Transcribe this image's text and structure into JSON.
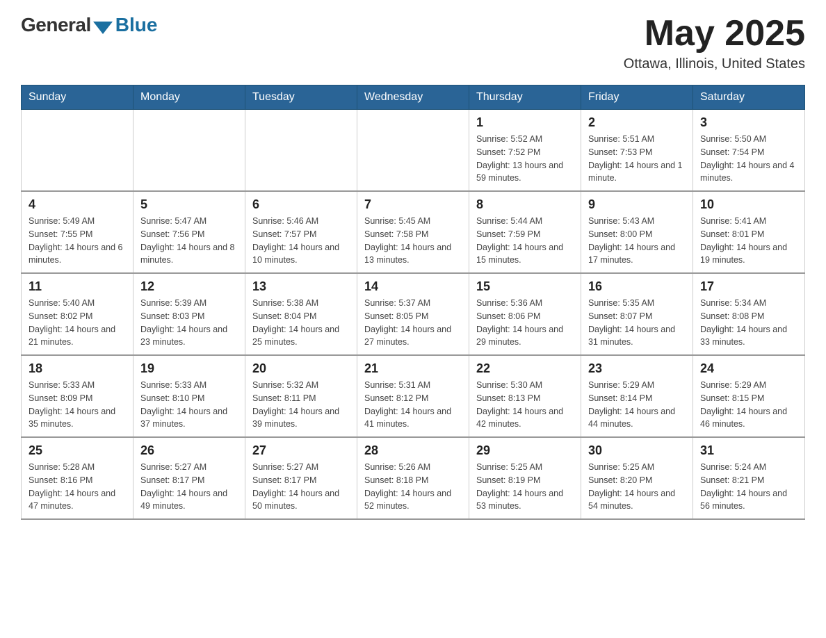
{
  "header": {
    "logo_general": "General",
    "logo_blue": "Blue",
    "month_year": "May 2025",
    "location": "Ottawa, Illinois, United States"
  },
  "days_of_week": [
    "Sunday",
    "Monday",
    "Tuesday",
    "Wednesday",
    "Thursday",
    "Friday",
    "Saturday"
  ],
  "weeks": [
    [
      {
        "day": "",
        "info": ""
      },
      {
        "day": "",
        "info": ""
      },
      {
        "day": "",
        "info": ""
      },
      {
        "day": "",
        "info": ""
      },
      {
        "day": "1",
        "info": "Sunrise: 5:52 AM\nSunset: 7:52 PM\nDaylight: 13 hours and 59 minutes."
      },
      {
        "day": "2",
        "info": "Sunrise: 5:51 AM\nSunset: 7:53 PM\nDaylight: 14 hours and 1 minute."
      },
      {
        "day": "3",
        "info": "Sunrise: 5:50 AM\nSunset: 7:54 PM\nDaylight: 14 hours and 4 minutes."
      }
    ],
    [
      {
        "day": "4",
        "info": "Sunrise: 5:49 AM\nSunset: 7:55 PM\nDaylight: 14 hours and 6 minutes."
      },
      {
        "day": "5",
        "info": "Sunrise: 5:47 AM\nSunset: 7:56 PM\nDaylight: 14 hours and 8 minutes."
      },
      {
        "day": "6",
        "info": "Sunrise: 5:46 AM\nSunset: 7:57 PM\nDaylight: 14 hours and 10 minutes."
      },
      {
        "day": "7",
        "info": "Sunrise: 5:45 AM\nSunset: 7:58 PM\nDaylight: 14 hours and 13 minutes."
      },
      {
        "day": "8",
        "info": "Sunrise: 5:44 AM\nSunset: 7:59 PM\nDaylight: 14 hours and 15 minutes."
      },
      {
        "day": "9",
        "info": "Sunrise: 5:43 AM\nSunset: 8:00 PM\nDaylight: 14 hours and 17 minutes."
      },
      {
        "day": "10",
        "info": "Sunrise: 5:41 AM\nSunset: 8:01 PM\nDaylight: 14 hours and 19 minutes."
      }
    ],
    [
      {
        "day": "11",
        "info": "Sunrise: 5:40 AM\nSunset: 8:02 PM\nDaylight: 14 hours and 21 minutes."
      },
      {
        "day": "12",
        "info": "Sunrise: 5:39 AM\nSunset: 8:03 PM\nDaylight: 14 hours and 23 minutes."
      },
      {
        "day": "13",
        "info": "Sunrise: 5:38 AM\nSunset: 8:04 PM\nDaylight: 14 hours and 25 minutes."
      },
      {
        "day": "14",
        "info": "Sunrise: 5:37 AM\nSunset: 8:05 PM\nDaylight: 14 hours and 27 minutes."
      },
      {
        "day": "15",
        "info": "Sunrise: 5:36 AM\nSunset: 8:06 PM\nDaylight: 14 hours and 29 minutes."
      },
      {
        "day": "16",
        "info": "Sunrise: 5:35 AM\nSunset: 8:07 PM\nDaylight: 14 hours and 31 minutes."
      },
      {
        "day": "17",
        "info": "Sunrise: 5:34 AM\nSunset: 8:08 PM\nDaylight: 14 hours and 33 minutes."
      }
    ],
    [
      {
        "day": "18",
        "info": "Sunrise: 5:33 AM\nSunset: 8:09 PM\nDaylight: 14 hours and 35 minutes."
      },
      {
        "day": "19",
        "info": "Sunrise: 5:33 AM\nSunset: 8:10 PM\nDaylight: 14 hours and 37 minutes."
      },
      {
        "day": "20",
        "info": "Sunrise: 5:32 AM\nSunset: 8:11 PM\nDaylight: 14 hours and 39 minutes."
      },
      {
        "day": "21",
        "info": "Sunrise: 5:31 AM\nSunset: 8:12 PM\nDaylight: 14 hours and 41 minutes."
      },
      {
        "day": "22",
        "info": "Sunrise: 5:30 AM\nSunset: 8:13 PM\nDaylight: 14 hours and 42 minutes."
      },
      {
        "day": "23",
        "info": "Sunrise: 5:29 AM\nSunset: 8:14 PM\nDaylight: 14 hours and 44 minutes."
      },
      {
        "day": "24",
        "info": "Sunrise: 5:29 AM\nSunset: 8:15 PM\nDaylight: 14 hours and 46 minutes."
      }
    ],
    [
      {
        "day": "25",
        "info": "Sunrise: 5:28 AM\nSunset: 8:16 PM\nDaylight: 14 hours and 47 minutes."
      },
      {
        "day": "26",
        "info": "Sunrise: 5:27 AM\nSunset: 8:17 PM\nDaylight: 14 hours and 49 minutes."
      },
      {
        "day": "27",
        "info": "Sunrise: 5:27 AM\nSunset: 8:17 PM\nDaylight: 14 hours and 50 minutes."
      },
      {
        "day": "28",
        "info": "Sunrise: 5:26 AM\nSunset: 8:18 PM\nDaylight: 14 hours and 52 minutes."
      },
      {
        "day": "29",
        "info": "Sunrise: 5:25 AM\nSunset: 8:19 PM\nDaylight: 14 hours and 53 minutes."
      },
      {
        "day": "30",
        "info": "Sunrise: 5:25 AM\nSunset: 8:20 PM\nDaylight: 14 hours and 54 minutes."
      },
      {
        "day": "31",
        "info": "Sunrise: 5:24 AM\nSunset: 8:21 PM\nDaylight: 14 hours and 56 minutes."
      }
    ]
  ]
}
